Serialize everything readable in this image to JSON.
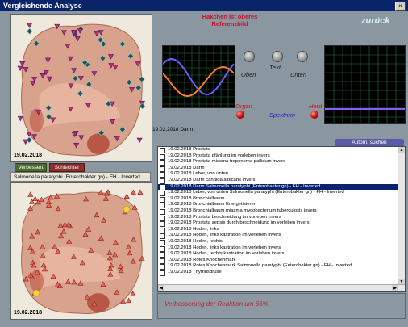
{
  "window": {
    "title": "Vergleichende Analyse",
    "close_glyph": "×"
  },
  "top_panel": {
    "date": "19.02.2018"
  },
  "buttons": {
    "improved": "Verbessert",
    "worse": "Schlechter"
  },
  "bottom_panel": {
    "label": "Salmonella paratyphi (Enterobakter gn) - FH - Inverted",
    "date": "19.02.2018"
  },
  "reference": {
    "text": "Häkchen ist oberes Referenzbild"
  },
  "back": {
    "label": "zurück"
  },
  "controls": {
    "oben": "Oben",
    "text": "Text",
    "unten": "Unten",
    "organ": "Organ",
    "spektrum": "Spektrum",
    "herd": "Herd"
  },
  "colors": {
    "wave1": "#ff7a2a",
    "wave2": "#6a5cff",
    "grid": "#1f7a3a",
    "flat": "#8a5cff",
    "marker_red": "#d4262e",
    "marker_dark": "#2a4a4a"
  },
  "current": {
    "date": "19.02.2018",
    "organ": "Darm"
  },
  "search_tab": {
    "label": "Autom. suchen"
  },
  "list": [
    {
      "date": "19.02.2018",
      "text": "Prostata",
      "checked": false,
      "selected": false
    },
    {
      "date": "19.02.2018",
      "text": "Prostata  pfählung im vorleben invers",
      "checked": false,
      "selected": false
    },
    {
      "date": "19.02.2018",
      "text": "Prostata  miasma treponema pallidum invers",
      "checked": false,
      "selected": false
    },
    {
      "date": "19.02.2018",
      "text": "Darm",
      "checked": true,
      "selected": false
    },
    {
      "date": "19.02.2018",
      "text": "Leber, von unten",
      "checked": false,
      "selected": false
    },
    {
      "date": "19.02.2018",
      "text": "Darm  candida albicans invers",
      "checked": false,
      "selected": false
    },
    {
      "date": "19.02.2018",
      "text": "Darm  Salmonella paratyphi (Enterobakter gn) - FH - Inverted",
      "checked": false,
      "selected": true
    },
    {
      "date": "19.02.2018",
      "text": "Leber, von unten  Salmonella paratyphi (Enterobakter gn) - FH - Inverted",
      "checked": false,
      "selected": false
    },
    {
      "date": "19.02.2018",
      "text": "Bronchialbaum",
      "checked": false,
      "selected": false
    },
    {
      "date": "19.02.2018",
      "text": "Bronchialbaum  Energetisieren",
      "checked": false,
      "selected": false
    },
    {
      "date": "19.02.2018",
      "text": "Bronchialbaum  miasma mycobacterium tuberculosis invers",
      "checked": false,
      "selected": false
    },
    {
      "date": "19.02.2018",
      "text": "Prostata  beschneidung im vorleben invers",
      "checked": false,
      "selected": false
    },
    {
      "date": "19.02.2018",
      "text": "Prostata  sepsis durch beschneidung im vorleben invers",
      "checked": false,
      "selected": false
    },
    {
      "date": "19.02.2018",
      "text": "Hoden, links",
      "checked": false,
      "selected": false
    },
    {
      "date": "19.02.2018",
      "text": "Hoden, links  kastration im vorleben invers",
      "checked": false,
      "selected": false
    },
    {
      "date": "19.02.2018",
      "text": "Hoden, rechts",
      "checked": false,
      "selected": false
    },
    {
      "date": "19.02.2018",
      "text": "Hoden, links  kastration im vorleben invers",
      "checked": false,
      "selected": false
    },
    {
      "date": "19.02.2018",
      "text": "Hoden, rechts  kastration im vorleben invers",
      "checked": false,
      "selected": false
    },
    {
      "date": "19.02.2018",
      "text": "Rotes Knochenmark",
      "checked": false,
      "selected": false
    },
    {
      "date": "19.02.2018",
      "text": "Rotes Knochenmark  Salmonella paratyphi (Enterobakter gn) - FH - Inverted",
      "checked": false,
      "selected": false
    },
    {
      "date": "19.02.2018",
      "text": "Thymusdrüse",
      "checked": false,
      "selected": false
    }
  ],
  "status": {
    "text": "Verbesserung der Reaktion um 66%"
  }
}
